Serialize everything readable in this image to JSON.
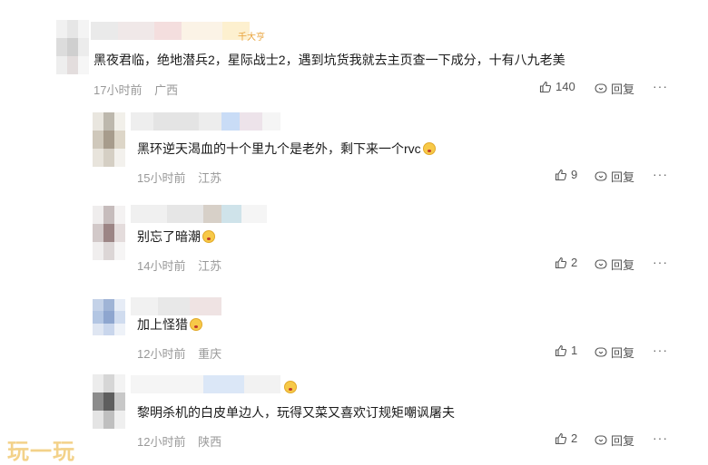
{
  "comments": [
    {
      "text": "黑夜君临，绝地潜兵2，星际战士2，遇到坑货我就去主页查一下成分，十有八九老美",
      "time": "17小时前",
      "location": "广西",
      "likes": "140",
      "reply_label": "回复",
      "badge": "千大亨"
    },
    {
      "text": "黑环逆天渴血的十个里九个是老外，剩下来一个rvc",
      "time": "15小时前",
      "location": "江苏",
      "likes": "9",
      "reply_label": "回复"
    },
    {
      "text": "别忘了暗潮",
      "time": "14小时前",
      "location": "江苏",
      "likes": "2",
      "reply_label": "回复"
    },
    {
      "text": "加上怪猎",
      "time": "12小时前",
      "location": "重庆",
      "likes": "1",
      "reply_label": "回复"
    },
    {
      "text": "黎明杀机的白皮单边人，玩得又菜又喜欢订规矩嘲讽屠夫",
      "time": "12小时前",
      "location": "陕西",
      "likes": "2",
      "reply_label": "回复"
    }
  ],
  "more_label": "···",
  "watermark": "玩一玩",
  "colors": {
    "meta_gray": "#999999",
    "text": "#1a1a1a",
    "background": "#ffffff"
  }
}
